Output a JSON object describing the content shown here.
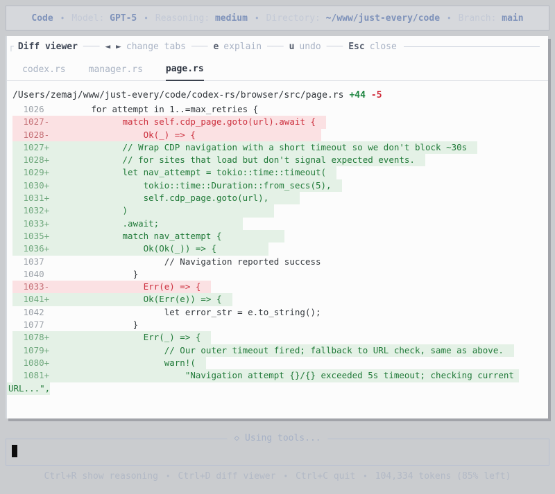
{
  "colors": {
    "accent_blue": "#7e92ba",
    "added_green": "#217a39",
    "removed_red": "#cc2f3d",
    "added_bg": "#e4f1e6",
    "removed_bg": "#fbe1e3"
  },
  "top_bar": {
    "app": "Code",
    "separator": "•",
    "items": [
      {
        "label": "Model: ",
        "value": "GPT-5"
      },
      {
        "label": "Reasoning: ",
        "value": "medium"
      },
      {
        "label": "Directory: ",
        "value": "~/www/just-every/code"
      },
      {
        "label": "Branch: ",
        "value": "main"
      }
    ]
  },
  "diff_viewer": {
    "title": "Diff viewer",
    "border_corner": "┌",
    "dash": "───",
    "shortcuts": [
      {
        "keys": "◄ ►",
        "action": "change tabs"
      },
      {
        "keys": "e",
        "action": "explain"
      },
      {
        "keys": "u",
        "action": "undo"
      },
      {
        "keys": "Esc",
        "action": "close"
      }
    ],
    "tabs": [
      {
        "label": "codex.rs",
        "active": false
      },
      {
        "label": "manager.rs",
        "active": false
      },
      {
        "label": "page.rs",
        "active": true
      }
    ],
    "file": {
      "path": "/Users/zemaj/www/just-every/code/codex-rs/browser/src/page.rs",
      "additions": "+44",
      "deletions": "-5"
    },
    "lines": [
      {
        "num": "1026",
        "mark": " ",
        "type": "ctx",
        "code": "        for attempt in 1..=max_retries {"
      },
      {
        "num": "1027",
        "mark": "-",
        "type": "del",
        "code": "              match self.cdp_page.goto(url).await {  "
      },
      {
        "num": "1028",
        "mark": "-",
        "type": "del",
        "code": "                  Ok(_) => {                        "
      },
      {
        "num": "1027",
        "mark": "+",
        "type": "add",
        "code": "              // Wrap CDP navigation with a short timeout so we don't block ~30s  "
      },
      {
        "num": "1028",
        "mark": "+",
        "type": "add",
        "code": "              // for sites that load but don't signal expected events.  "
      },
      {
        "num": "1029",
        "mark": "+",
        "type": "add",
        "code": "              let nav_attempt = tokio::time::timeout(  "
      },
      {
        "num": "1030",
        "mark": "+",
        "type": "add",
        "code": "                  tokio::time::Duration::from_secs(5),  "
      },
      {
        "num": "1031",
        "mark": "+",
        "type": "add",
        "code": "                  self.cdp_page.goto(url),      "
      },
      {
        "num": "1032",
        "mark": "+",
        "type": "add",
        "code": "              )                            "
      },
      {
        "num": "1033",
        "mark": "+",
        "type": "add",
        "code": "              .await;                "
      },
      {
        "num": "1035",
        "mark": "+",
        "type": "add",
        "code": "              match nav_attempt {            "
      },
      {
        "num": "1036",
        "mark": "+",
        "type": "add",
        "code": "                  Ok(Ok(_)) => {          "
      },
      {
        "num": "1037",
        "mark": " ",
        "type": "ctx",
        "code": "                      // Navigation reported success"
      },
      {
        "num": "1040",
        "mark": " ",
        "type": "ctx",
        "code": "                }"
      },
      {
        "num": "1033",
        "mark": "-",
        "type": "del",
        "code": "                  Err(e) => {  "
      },
      {
        "num": "1041",
        "mark": "+",
        "type": "add",
        "code": "                  Ok(Err(e)) => {  "
      },
      {
        "num": "1042",
        "mark": " ",
        "type": "ctx",
        "code": "                      let error_str = e.to_string();"
      },
      {
        "num": "1077",
        "mark": " ",
        "type": "ctx",
        "code": "                }"
      },
      {
        "num": "1078",
        "mark": "+",
        "type": "add",
        "code": "                  Err(_) => {  "
      },
      {
        "num": "1079",
        "mark": "+",
        "type": "add",
        "code": "                      // Our outer timeout fired; fallback to URL check, same as above.  "
      },
      {
        "num": "1080",
        "mark": "+",
        "type": "add",
        "code": "                      warn!(  "
      },
      {
        "num": "1081",
        "mark": "+",
        "type": "add",
        "code": "                          \"Navigation attempt {}/{} exceeded 5s timeout; checking current "
      },
      {
        "num": "",
        "mark": "",
        "type": "add",
        "wrap": true,
        "code": "URL...\","
      }
    ]
  },
  "status": {
    "label": "◇ Using tools..."
  },
  "footer": {
    "separator": "•",
    "items": [
      "Ctrl+R show reasoning",
      "Ctrl+D diff viewer",
      "Ctrl+C quit",
      "104,334 tokens (85% left)"
    ]
  }
}
